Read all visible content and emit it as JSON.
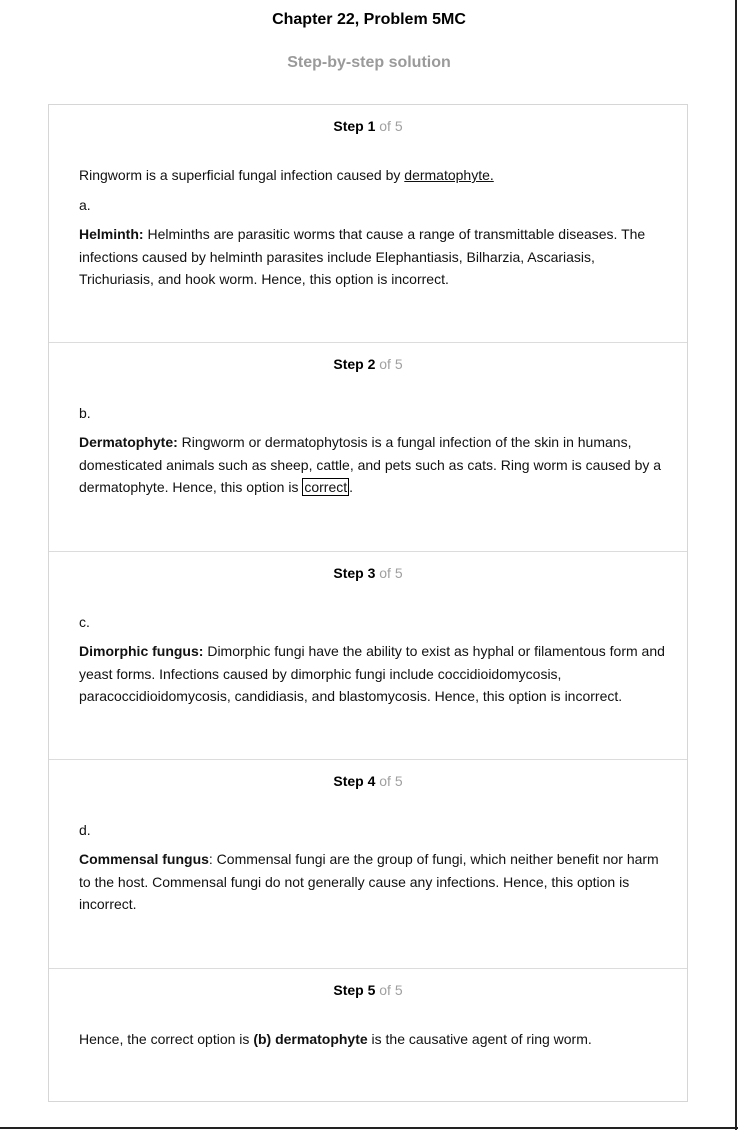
{
  "header": {
    "title": "Chapter 22, Problem 5MC",
    "subtitle": "Step-by-step solution"
  },
  "step_of_label": "of 5",
  "steps": [
    {
      "label": "Step 1",
      "intro_pre": "Ringworm is a superficial fungal infection caused by ",
      "intro_link": "dermatophyte.",
      "letter": "a.",
      "term": "Helminth:",
      "text": " Helminths are parasitic worms that cause a range of transmittable diseases. The infections caused by helminth parasites include Elephantiasis, Bilharzia, Ascariasis, Trichuriasis, and hook worm. Hence, this option is incorrect."
    },
    {
      "label": "Step 2",
      "letter": "b.",
      "term": "Dermatophyte:",
      "text": " Ringworm or dermatophytosis is a fungal infection of the skin in humans, domesticated animals such as sheep, cattle, and pets such as cats. Ring worm is caused by a dermatophyte. Hence, this option is ",
      "boxed": "correct",
      "after": "."
    },
    {
      "label": "Step 3",
      "letter": "c.",
      "term": "Dimorphic fungus:",
      "text": " Dimorphic fungi have the ability to exist as hyphal or filamentous form and yeast forms. Infections caused by dimorphic fungi include coccidioidomycosis, paracoccidioidomycosis, candidiasis, and blastomycosis. Hence, this option is incorrect."
    },
    {
      "label": "Step 4",
      "letter": "d.",
      "term": "Commensal fungus",
      "text": ": Commensal fungi are the group of fungi, which neither benefit nor harm to the host. Commensal fungi do not generally cause any infections. Hence, this option is incorrect."
    },
    {
      "label": "Step 5",
      "pre": "Hence, the correct option is ",
      "bold": "(b) dermatophyte",
      "post": " is the causative agent of ring worm."
    }
  ]
}
